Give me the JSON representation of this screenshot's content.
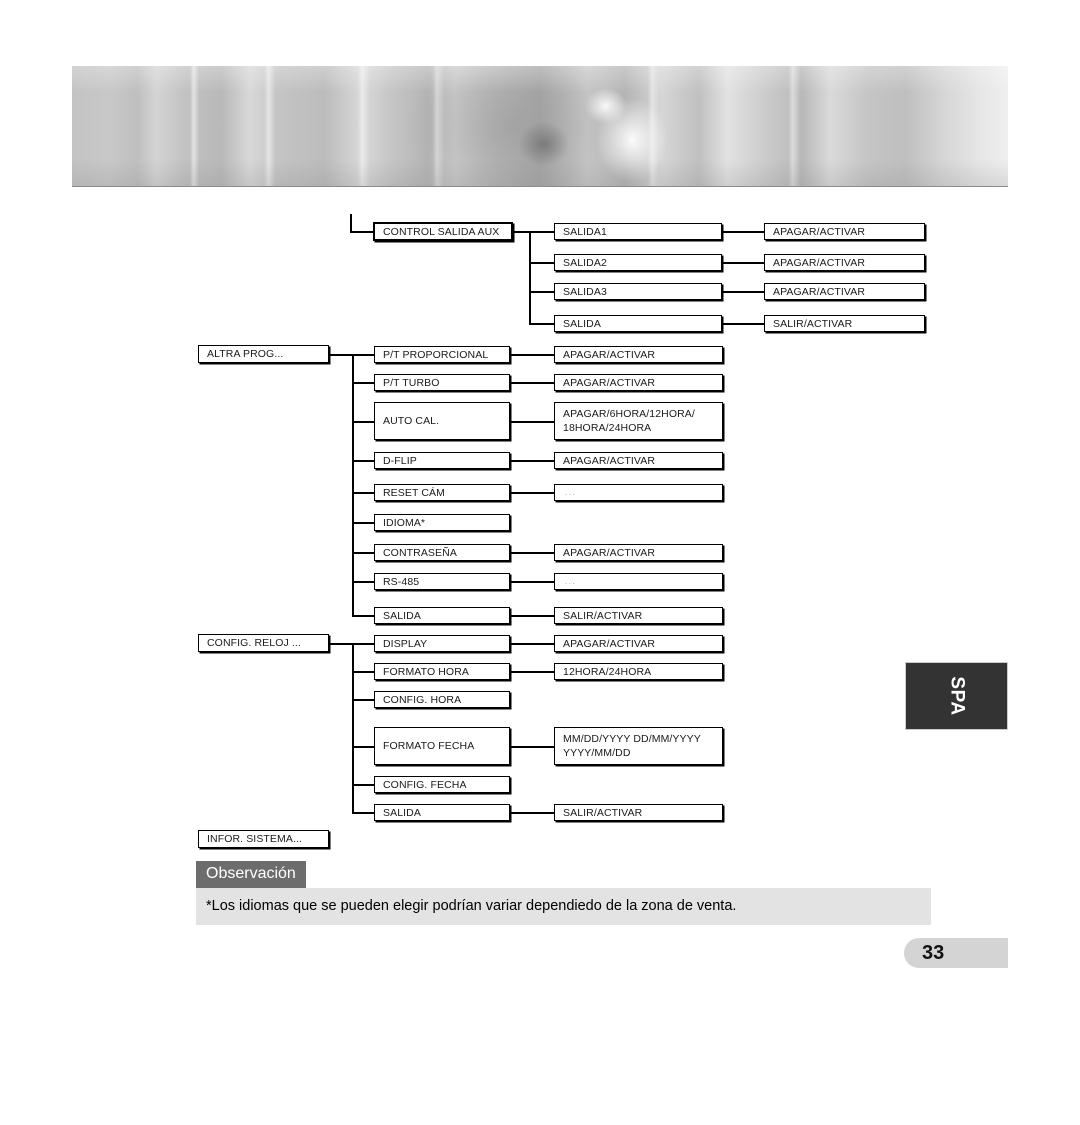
{
  "page": {
    "number": "33",
    "side_tab": "SPA"
  },
  "header": {
    "image_alt": "camera-lens-photo-strip"
  },
  "diagram": {
    "groups": [
      {
        "id": "control-salida-aux",
        "root": "CONTROL SALIDA AUX",
        "items": [
          {
            "label": "SALIDA1",
            "value": "APAGAR/ACTIVAR"
          },
          {
            "label": "SALIDA2",
            "value": "APAGAR/ACTIVAR"
          },
          {
            "label": "SALIDA3",
            "value": "APAGAR/ACTIVAR"
          },
          {
            "label": "SALIDA",
            "value": "SALIR/ACTIVAR"
          }
        ]
      },
      {
        "id": "altra-prog",
        "root": "ALTRA PROG...",
        "items": [
          {
            "label": "P/T PROPORCIONAL",
            "value": "APAGAR/ACTIVAR"
          },
          {
            "label": "P/T TURBO",
            "value": "APAGAR/ACTIVAR"
          },
          {
            "label": "AUTO CAL.",
            "value": "APAGAR/6HORA/12HORA/\n18HORA/24HORA"
          },
          {
            "label": "D-FLIP",
            "value": "APAGAR/ACTIVAR"
          },
          {
            "label": "RESET CÁM",
            "value": "..."
          },
          {
            "label": "IDIOMA*",
            "value": ""
          },
          {
            "label": "CONTRASEÑA",
            "value": "APAGAR/ACTIVAR"
          },
          {
            "label": "RS-485",
            "value": "..."
          },
          {
            "label": "SALIDA",
            "value": "SALIR/ACTIVAR"
          }
        ]
      },
      {
        "id": "config-reloj",
        "root": "CONFIG. RELOJ ...",
        "items": [
          {
            "label": "DISPLAY",
            "value": "APAGAR/ACTIVAR"
          },
          {
            "label": "FORMATO HORA",
            "value": "12HORA/24HORA"
          },
          {
            "label": "CONFIG. HORA",
            "value": ""
          },
          {
            "label": "FORMATO FECHA",
            "value": "MM/DD/YYYY DD/MM/YYYY\nYYYY/MM/DD"
          },
          {
            "label": "CONFIG. FECHA",
            "value": ""
          },
          {
            "label": "SALIDA",
            "value": "SALIR/ACTIVAR"
          }
        ]
      },
      {
        "id": "infor-sistema",
        "root": "INFOR. SISTEMA...",
        "items": []
      }
    ]
  },
  "observation": {
    "title": "Observación",
    "text": "*Los idiomas que se pueden elegir podrían variar dependiedo de la zona de venta."
  },
  "colors": {
    "tab_background": "#333333",
    "observation_title_background": "#6d6d6d",
    "observation_body_background": "#e3e3e3",
    "page_pill_background": "#d4d4d4"
  }
}
